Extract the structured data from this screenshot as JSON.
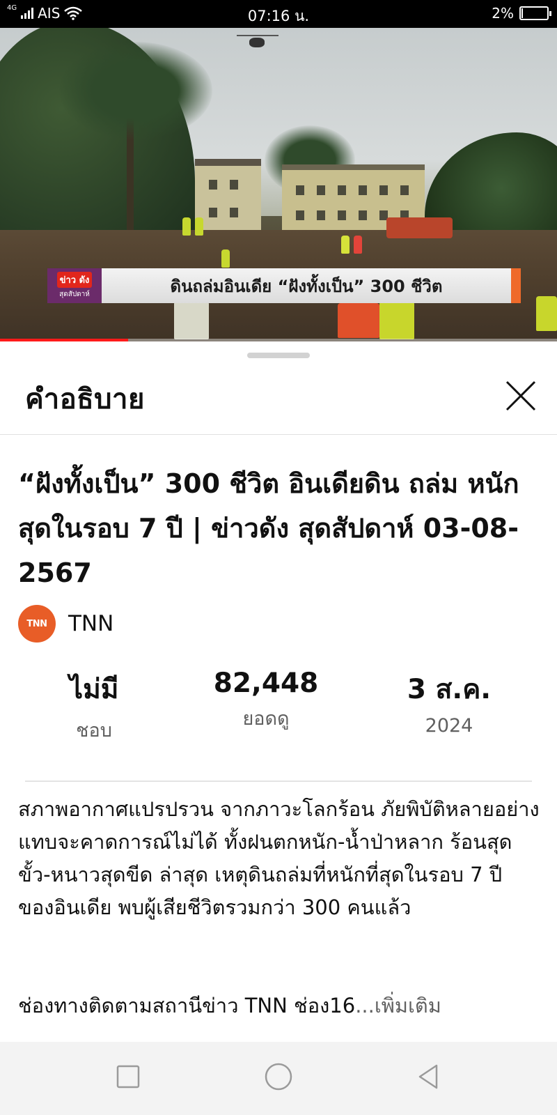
{
  "status_bar": {
    "network": "4G",
    "carrier": "AIS",
    "time": "07:16 น.",
    "battery": "2%",
    "battery_level": 0.02
  },
  "video": {
    "banner_logo_line1": "ข่าว ดัง",
    "banner_logo_line2": "สุดสัปดาห์",
    "banner_text": "ดินถล่มอินเดีย “ฝังทั้งเป็น” 300 ชีวิต",
    "progress_fraction": 0.23
  },
  "sheet": {
    "title": "คำอธิบาย",
    "video_title": "“ฝังทั้งเป็น” 300 ชีวิต อินเดียดิน ถล่ม หนักสุดในรอบ 7 ปี | ข่าวดัง สุดสัปดาห์ 03-08-2567",
    "channel": {
      "avatar_text": "TNN",
      "name": "TNN"
    },
    "stats": [
      {
        "value": "ไม่มี",
        "label": "ชอบ"
      },
      {
        "value": "82,448",
        "label": "ยอดดู"
      },
      {
        "value": "3 ส.ค.",
        "label": "2024"
      }
    ],
    "description": "สภาพอากาศแปรปรวน จากภาวะโลกร้อน ภัยพิบัติหลายอย่างแทบจะคาดการณ์ไม่ได้ ทั้งฝนตกหนัก-น้ำป่าหลาก ร้อนสุดขั้ว-หนาวสุดขีด ล่าสุด เหตุดินถล่มที่หนักที่สุดในรอบ 7 ปี ของอินเดีย พบผู้เสียชีวิตรวมกว่า 300 คนแล้ว",
    "follow_text": "ช่องทางติดตามสถานีข่าว TNN ช่อง16",
    "more_label": "...เพิ่มเติม"
  },
  "nav_bar": {
    "buttons": [
      "recent-apps",
      "home",
      "back"
    ]
  }
}
